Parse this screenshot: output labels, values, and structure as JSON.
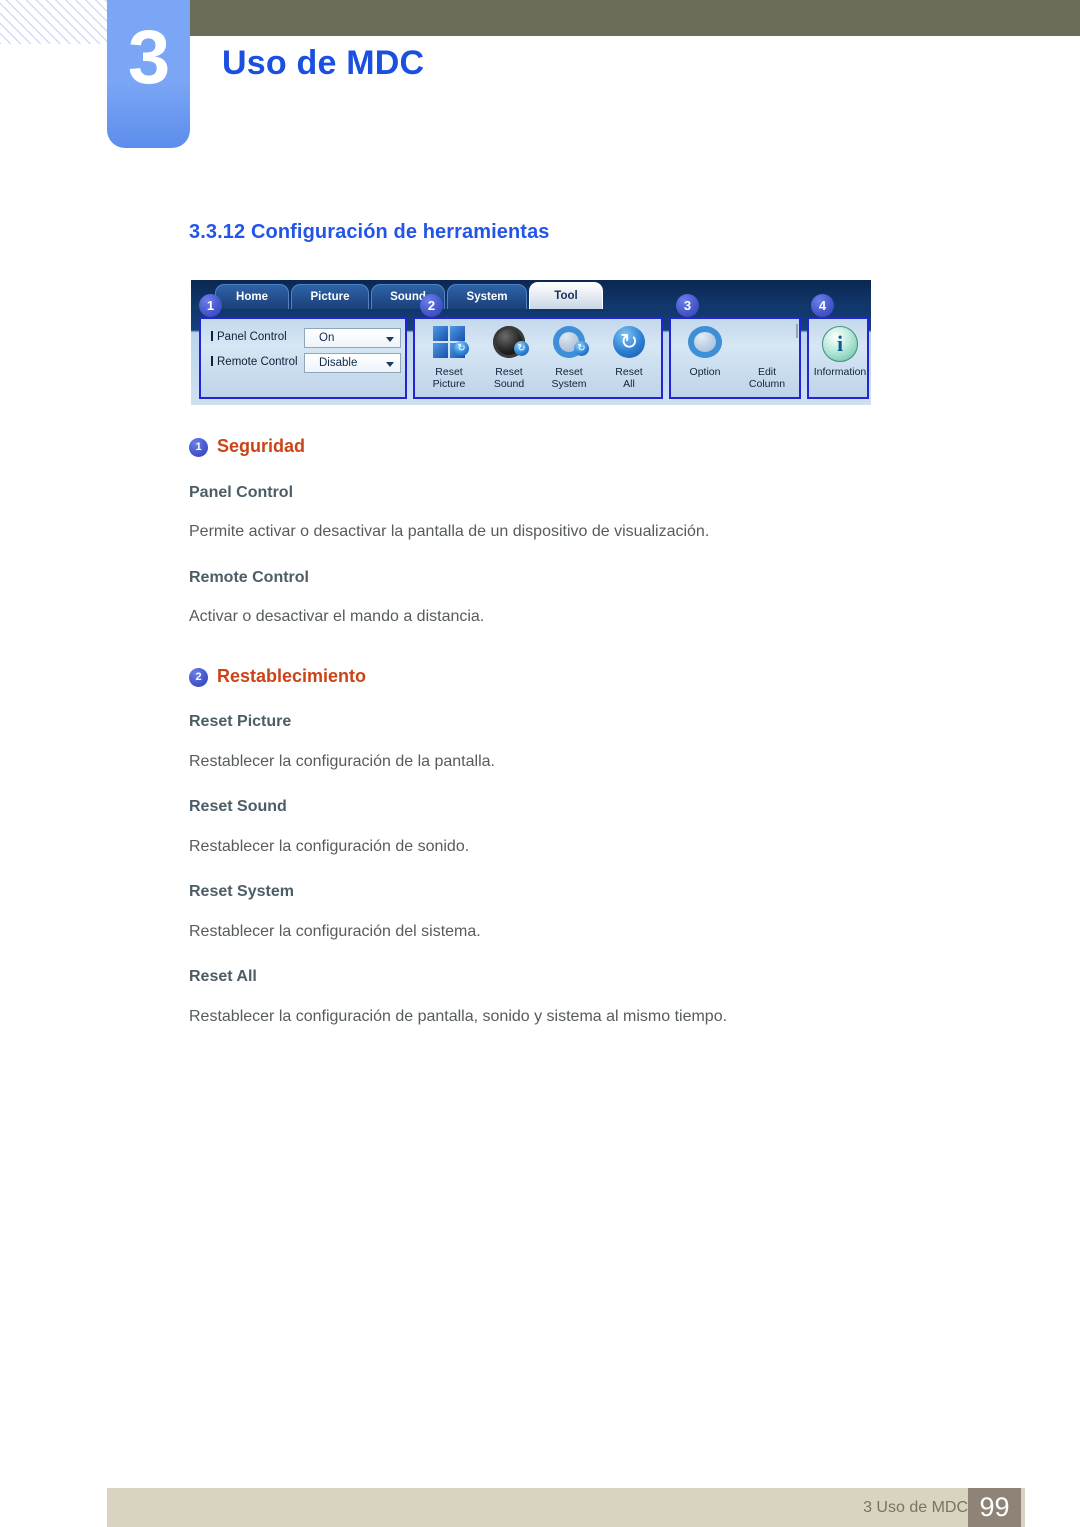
{
  "header": {
    "chapter_number": "3",
    "chapter_title": "Uso de MDC",
    "olive_color": "#6d6c58",
    "tab_color": "#7ba6f5",
    "title_color": "#1a4fe0"
  },
  "section": {
    "number": "3.3.12",
    "title": "Configuración de herramientas",
    "color": "#2255e8"
  },
  "figure": {
    "alt": "MDC Tool tab ribbon screenshot",
    "tabs": [
      {
        "label": "Home",
        "active": false
      },
      {
        "label": "Picture",
        "active": false
      },
      {
        "label": "Sound",
        "active": false
      },
      {
        "label": "System",
        "active": false
      },
      {
        "label": "Tool",
        "active": true
      }
    ],
    "badges": [
      "1",
      "2",
      "3",
      "4"
    ],
    "group1": {
      "rows": [
        {
          "label": "Panel Control",
          "value": "On"
        },
        {
          "label": "Remote Control",
          "value": "Disable"
        }
      ]
    },
    "group2": {
      "buttons": [
        {
          "line1": "Reset",
          "line2": "Picture",
          "icon": "grid-refresh-icon"
        },
        {
          "line1": "Reset",
          "line2": "Sound",
          "icon": "speaker-refresh-icon"
        },
        {
          "line1": "Reset",
          "line2": "System",
          "icon": "gear-refresh-icon"
        },
        {
          "line1": "Reset",
          "line2": "All",
          "icon": "refresh-icon"
        }
      ]
    },
    "group3": {
      "buttons": [
        {
          "line1": "Option",
          "line2": "",
          "icon": "gear-wrench-icon"
        },
        {
          "line1": "Edit",
          "line2": "Column",
          "icon": "edit-column-icon"
        }
      ]
    },
    "group4": {
      "buttons": [
        {
          "line1": "Information",
          "line2": "",
          "icon": "information-icon"
        }
      ]
    }
  },
  "sections": [
    {
      "badge": "1",
      "title": "Seguridad",
      "items": [
        {
          "heading": "Panel Control",
          "body": "Permite activar o desactivar la pantalla de un dispositivo de visualización."
        },
        {
          "heading": "Remote Control",
          "body": "Activar o desactivar el mando a distancia."
        }
      ]
    },
    {
      "badge": "2",
      "title": "Restablecimiento",
      "items": [
        {
          "heading": "Reset Picture",
          "body": "Restablecer la configuración de la pantalla."
        },
        {
          "heading": "Reset Sound",
          "body": "Restablecer la configuración de sonido."
        },
        {
          "heading": "Reset System",
          "body": "Restablecer la configuración del sistema."
        },
        {
          "heading": "Reset All",
          "body": "Restablecer la configuración de pantalla, sonido y sistema al mismo tiempo."
        }
      ]
    }
  ],
  "footer": {
    "text": "3 Uso de MDC",
    "page_number": "99",
    "bar_color": "#d9d4c0",
    "page_box_color": "#8e8376"
  },
  "icons": {
    "caret_down": "▼",
    "refresh": "⟳",
    "info": "i"
  }
}
